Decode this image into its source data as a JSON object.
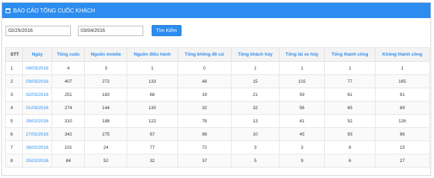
{
  "header": {
    "title": "BÁO CÁO TỔNG CUỐC KHÁCH",
    "icon": "calendar-icon"
  },
  "filters": {
    "from_date": "02/25/2016",
    "to_date": "03/04/2016",
    "search_label": "Tìm Kiếm"
  },
  "colors": {
    "accent": "#2d8cf0",
    "header_bg": "#f3f3f3"
  },
  "table": {
    "columns": [
      "STT",
      "Ngày",
      "Tổng cuốc",
      "Nguồn mobile",
      "Nguồn điều hành",
      "Tổng không đề cử",
      "Tổng khách hủy",
      "Tổng lái xe hủy",
      "Tổng thành công",
      "Không thành công"
    ],
    "rows": [
      [
        "1",
        "04/03/2016",
        "4",
        "3",
        "1",
        "0",
        "1",
        "1",
        "1",
        "1"
      ],
      [
        "2",
        "03/03/2016",
        "407",
        "272",
        "133",
        "48",
        "15",
        "102",
        "77",
        "165"
      ],
      [
        "3",
        "02/03/2016",
        "251",
        "183",
        "68",
        "19",
        "21",
        "59",
        "61",
        "91"
      ],
      [
        "4",
        "01/03/2016",
        "274",
        "144",
        "130",
        "32",
        "32",
        "56",
        "65",
        "89"
      ],
      [
        "5",
        "29/02/2016",
        "310",
        "188",
        "122",
        "78",
        "13",
        "41",
        "52",
        "126"
      ],
      [
        "6",
        "27/02/2016",
        "342",
        "275",
        "67",
        "98",
        "10",
        "45",
        "93",
        "96"
      ],
      [
        "7",
        "26/02/2016",
        "101",
        "24",
        "77",
        "72",
        "3",
        "3",
        "8",
        "15"
      ],
      [
        "8",
        "25/02/2016",
        "84",
        "52",
        "32",
        "37",
        "5",
        "9",
        "6",
        "27"
      ]
    ]
  }
}
